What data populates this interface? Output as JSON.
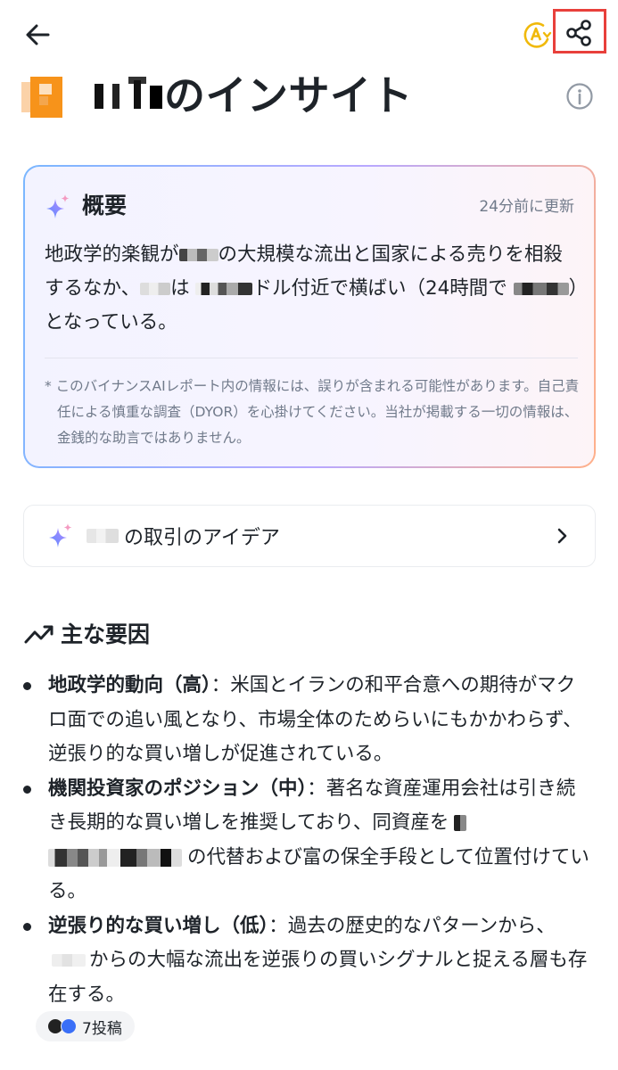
{
  "header": {
    "back_icon": "back-arrow-icon",
    "translate_icon": "translate-icon",
    "share_icon": "share-icon",
    "share_highlight_color": "#e8403b"
  },
  "page": {
    "title_suffix": "のインサイト",
    "info_icon": "info-icon"
  },
  "overview": {
    "title": "概要",
    "updated": "24分前に更新",
    "body_p1": "地政学的楽観が",
    "body_p2": "の大規模な流出と国家による売りを相殺するなか、",
    "body_p3": "は",
    "body_p4": "ドル付近で横ばい（24時間で",
    "body_p5": "）となっている。",
    "disclaimer": "* このバイナンスAIレポート内の情報には、誤りが含まれる可能性があります。自己責任による慎重な調査（DYOR）を心掛けてください。当社が掲載する一切の情報は、金銭的な助言ではありません。"
  },
  "trade_ideas": {
    "label_suffix": "の取引のアイデア"
  },
  "factors": {
    "title": "主な要因",
    "items": [
      {
        "heading": "地政学的動向（高）",
        "text": "：米国とイランの和平合意への期待がマクロ面での追い風となり、市場全体のためらいにもかかわらず、逆張り的な買い増しが促進されている。"
      },
      {
        "heading": "機関投資家のポジション（中）",
        "text_a": "：著名な資産運用会社は引き続き長期的な買い増しを推奨しており、同資産を",
        "text_b": "の代替および富の保全手段として位置付けている。"
      },
      {
        "heading": "逆張り的な買い増し（低）",
        "text_a": "：過去の歴史的なパターンから、",
        "text_b": "からの大幅な流出を逆張りの買いシグナルと捉える層も存在する。"
      }
    ]
  },
  "posts": {
    "count_label": "7投稿"
  },
  "colors": {
    "text": "#1e2329",
    "muted": "#707a8a",
    "brand_orange": "#f7931a"
  }
}
